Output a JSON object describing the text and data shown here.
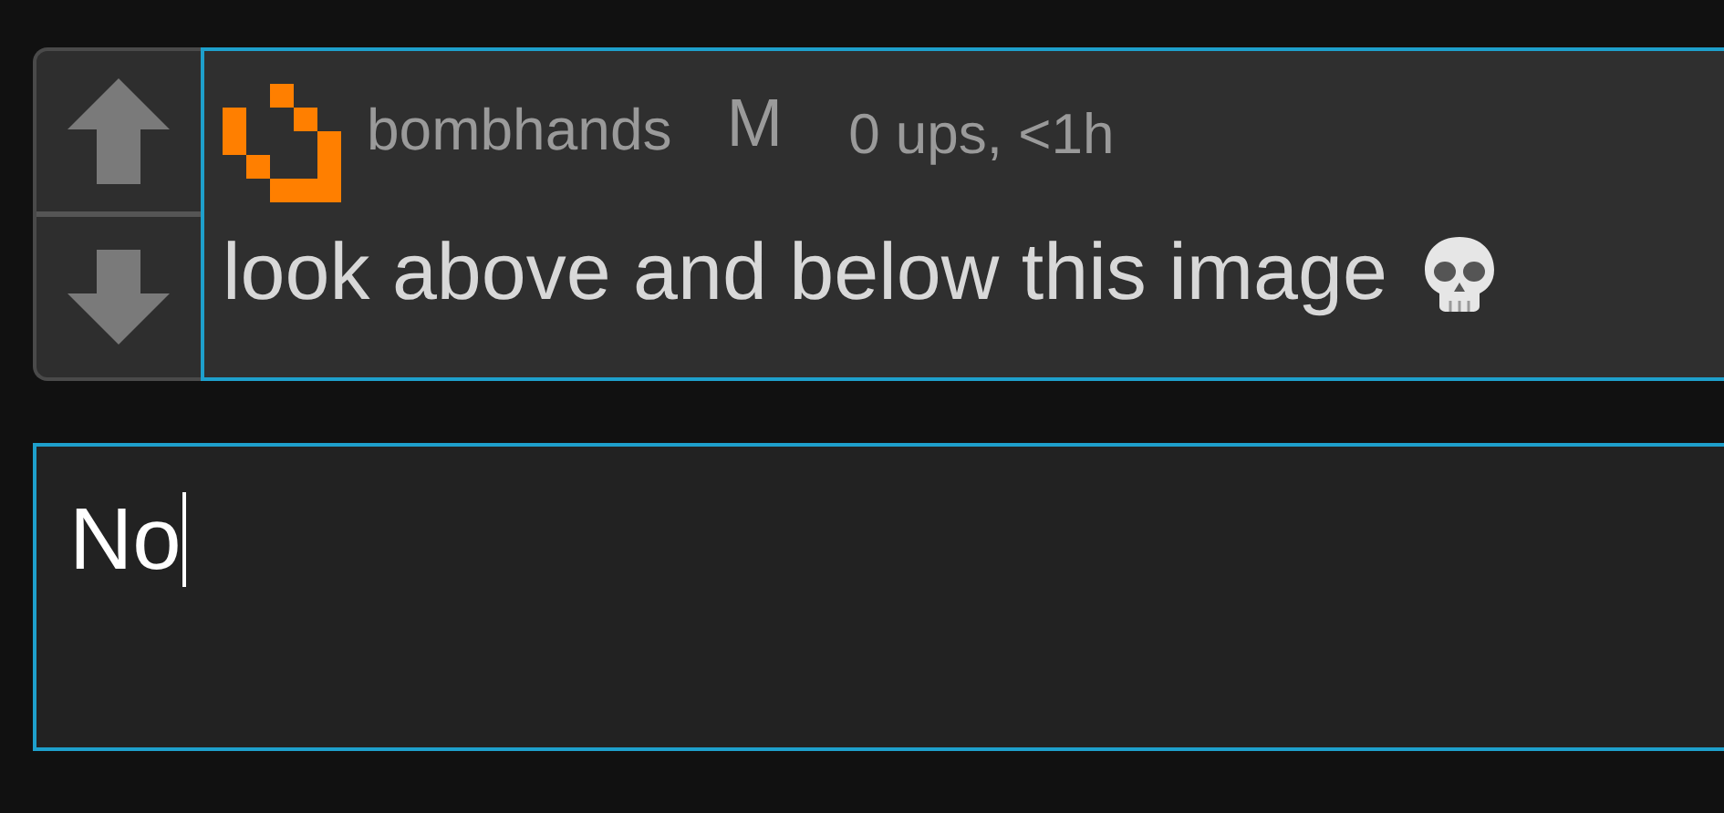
{
  "comment": {
    "upvoted": false,
    "downvoted": false,
    "username": "bombhands",
    "badge": "M",
    "meta": "0 ups, <1h",
    "text": "look above and below this image"
  },
  "reply": {
    "value": "No",
    "focused": true
  }
}
